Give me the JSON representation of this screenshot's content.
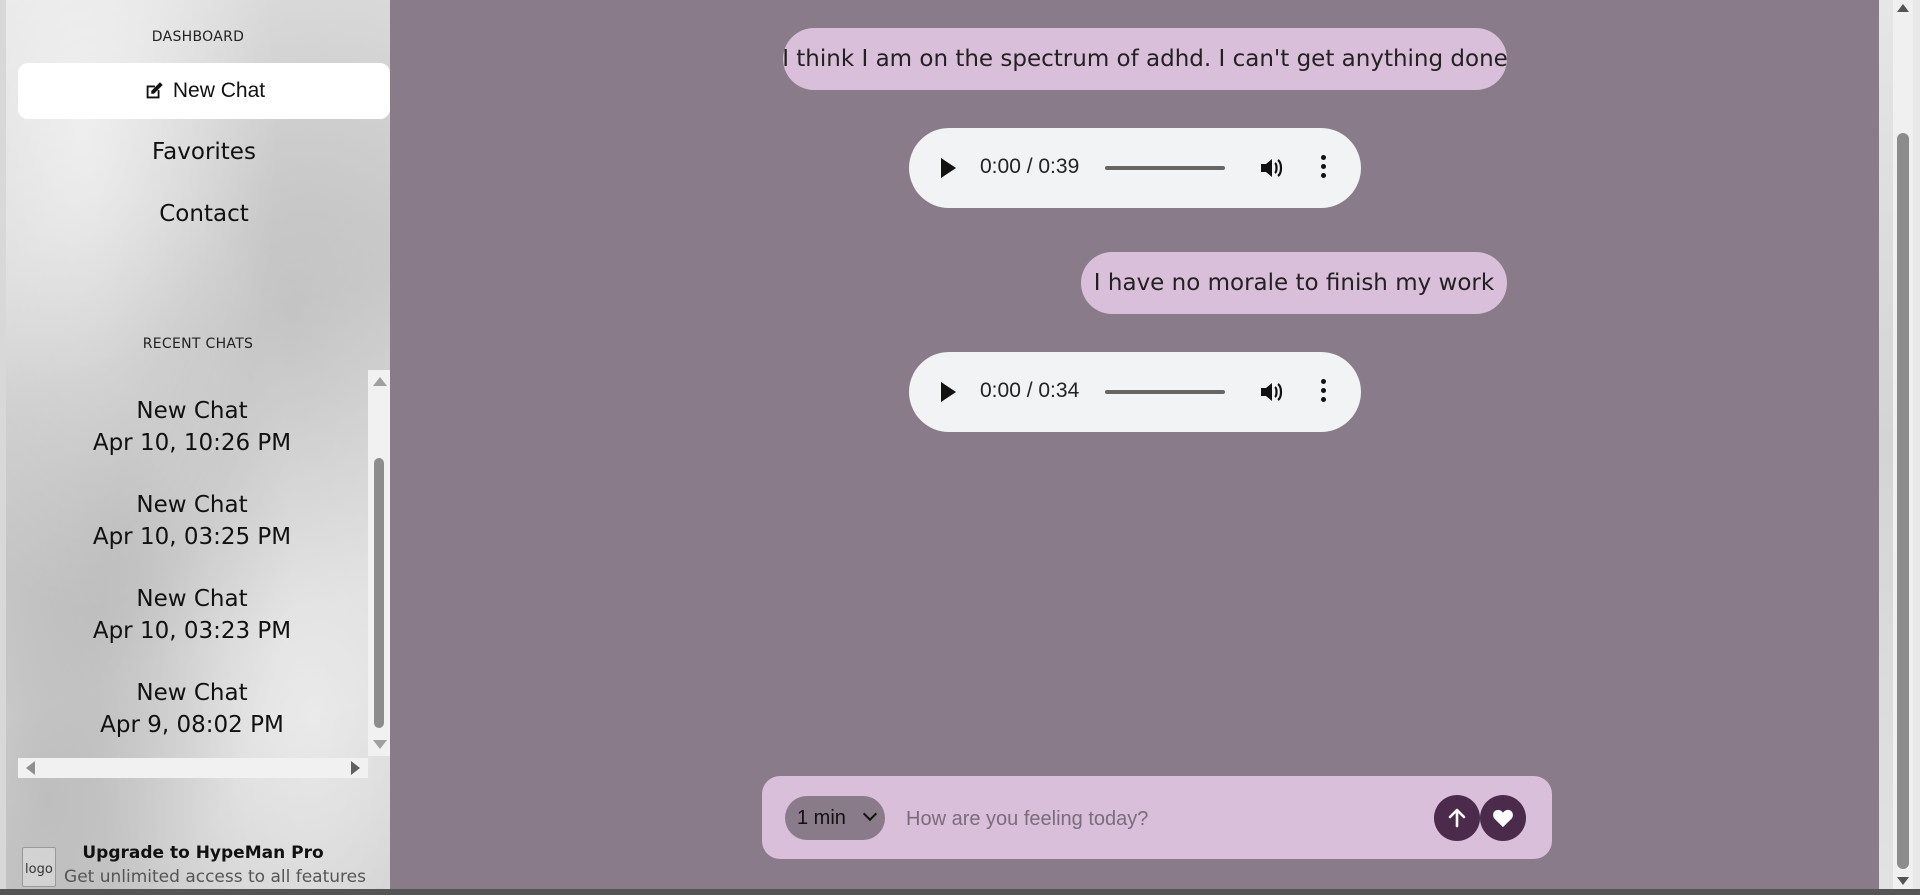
{
  "sidebar": {
    "dashboard_title": "DASHBOARD",
    "nav": {
      "new_chat": "New Chat",
      "favorites": "Favorites",
      "contact": "Contact"
    },
    "recent_title": "RECENT CHATS",
    "recent_chats": [
      {
        "title": "New Chat",
        "date": "Apr 10, 10:26 PM"
      },
      {
        "title": "New Chat",
        "date": "Apr 10, 03:25 PM"
      },
      {
        "title": "New Chat",
        "date": "Apr 10, 03:23 PM"
      },
      {
        "title": "New Chat",
        "date": "Apr 9, 08:02 PM"
      }
    ],
    "upgrade": {
      "logo_alt": "logo",
      "title": "Upgrade to HypeMan Pro",
      "subtitle": "Get unlimited access to all features"
    }
  },
  "messages": [
    {
      "text": "I think I am on the spectrum of adhd. I can't get anything done",
      "audio_time": "0:00 / 0:39"
    },
    {
      "text": "I have no morale to finish my work",
      "audio_time": "0:00 / 0:34"
    }
  ],
  "composer": {
    "duration_selected": "1 min",
    "placeholder": "How are you feeling today?"
  },
  "colors": {
    "main_bg": "#897b89",
    "bubble_bg": "#d9bfd9",
    "accent_button": "#4c2a4c"
  },
  "icons": [
    "edit-icon",
    "play-icon",
    "volume-icon",
    "more-options-icon",
    "chevron-down-icon",
    "arrow-up-icon",
    "heart-icon"
  ]
}
